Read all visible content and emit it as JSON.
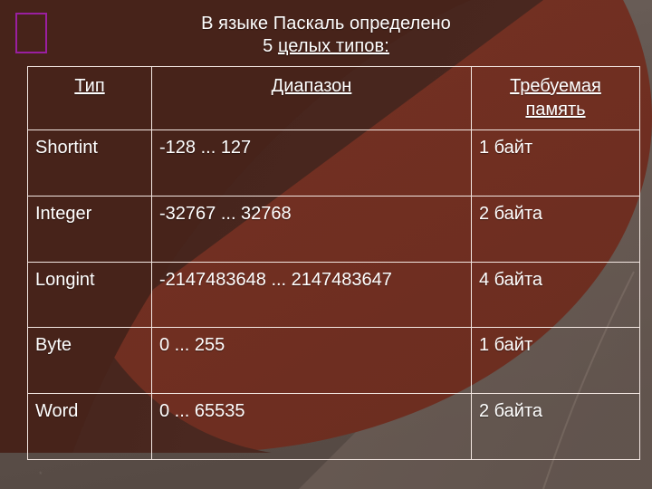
{
  "slide": {
    "title_line1": "В языке Паскаль определено",
    "title_line2_prefix": "5 ",
    "title_line2_underlined": "целых типов:",
    "footer_marker": "*",
    "colors": {
      "background_dark_brown": "#47231a",
      "background_mid_brown": "#6b3a2c",
      "background_gray_brown": "#594d47",
      "background_light_gray": "#6d615b",
      "border_white": "#f3e7e2",
      "text_white": "#ffffff",
      "accent_purple": "#9a1fa0"
    }
  },
  "table": {
    "headers": [
      "Тип",
      "Диапазон",
      "Требуемая память"
    ],
    "rows": [
      {
        "type": "Shortint",
        "range": "-128 ... 127",
        "memory": "1 байт"
      },
      {
        "type": "Integer",
        "range": "-32767 ... 32768",
        "memory": "2 байта"
      },
      {
        "type": "Longint",
        "range": "-2147483648 ... 2147483647",
        "memory": "4 байта"
      },
      {
        "type": "Byte",
        "range": "0 ... 255",
        "memory": "1 байт"
      },
      {
        "type": "Word",
        "range": "0 ... 65535",
        "memory": "2 байта"
      }
    ]
  }
}
